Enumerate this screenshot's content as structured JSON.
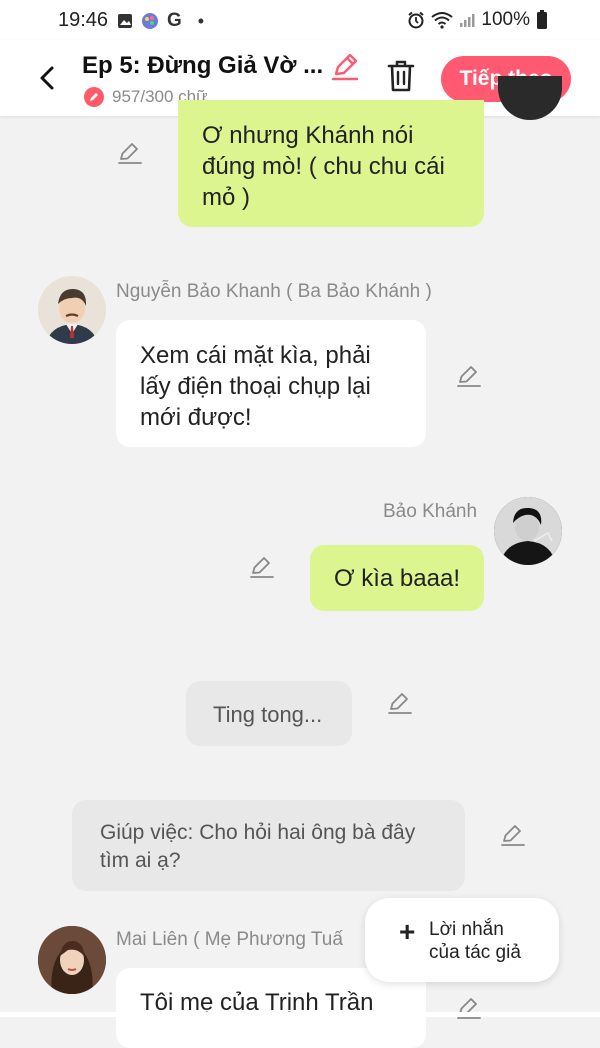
{
  "status_bar": {
    "time": "19:46",
    "g_icon": "G",
    "dot": "•",
    "battery_pct": "100%"
  },
  "header": {
    "title": "Ep 5: Đừng Giả Vờ ...",
    "word_count": "957/300 chữ",
    "next_label": "Tiếp theo"
  },
  "messages": {
    "m1_text_l1": "Ơ nhưng Khánh nói",
    "m1_text_l2": "đúng mò! ( chu chu cái",
    "m1_text_l3": "mỏ )",
    "m2_name": "Nguyễn Bảo Khanh ( Ba Bảo Khánh )",
    "m2_text_l1": "Xem cái mặt kìa, phải",
    "m2_text_l2": "lấy điện thoại chụp lại",
    "m2_text_l3": "mới được!",
    "m3_name": "Bảo Khánh",
    "m3_text": "Ơ kìa baaa!",
    "m4_text": "Ting tong...",
    "m5_text_l1": "Giúp việc: Cho hỏi hai ông bà đây",
    "m5_text_l2": "tìm ai ạ?",
    "m6_name": "Mai Liên ( Mẹ Phương Tuấ",
    "m6_text": "Tôi mẹ của Trịnh Trần"
  },
  "fab": {
    "plus": "+",
    "label_l1": "Lời nhắn",
    "label_l2": "của tác giả"
  },
  "colors": {
    "accent": "#ff5a72",
    "bubble_green": "#dcf58f",
    "bubble_white": "#ffffff",
    "bubble_gray": "#e8e8e8"
  },
  "icons": [
    "image-icon",
    "palette-icon",
    "alarm-icon",
    "wifi-icon",
    "signal-icon",
    "battery-icon",
    "back-arrow-icon",
    "pencil-icon",
    "trash-icon",
    "edit-icon",
    "plus-icon"
  ]
}
